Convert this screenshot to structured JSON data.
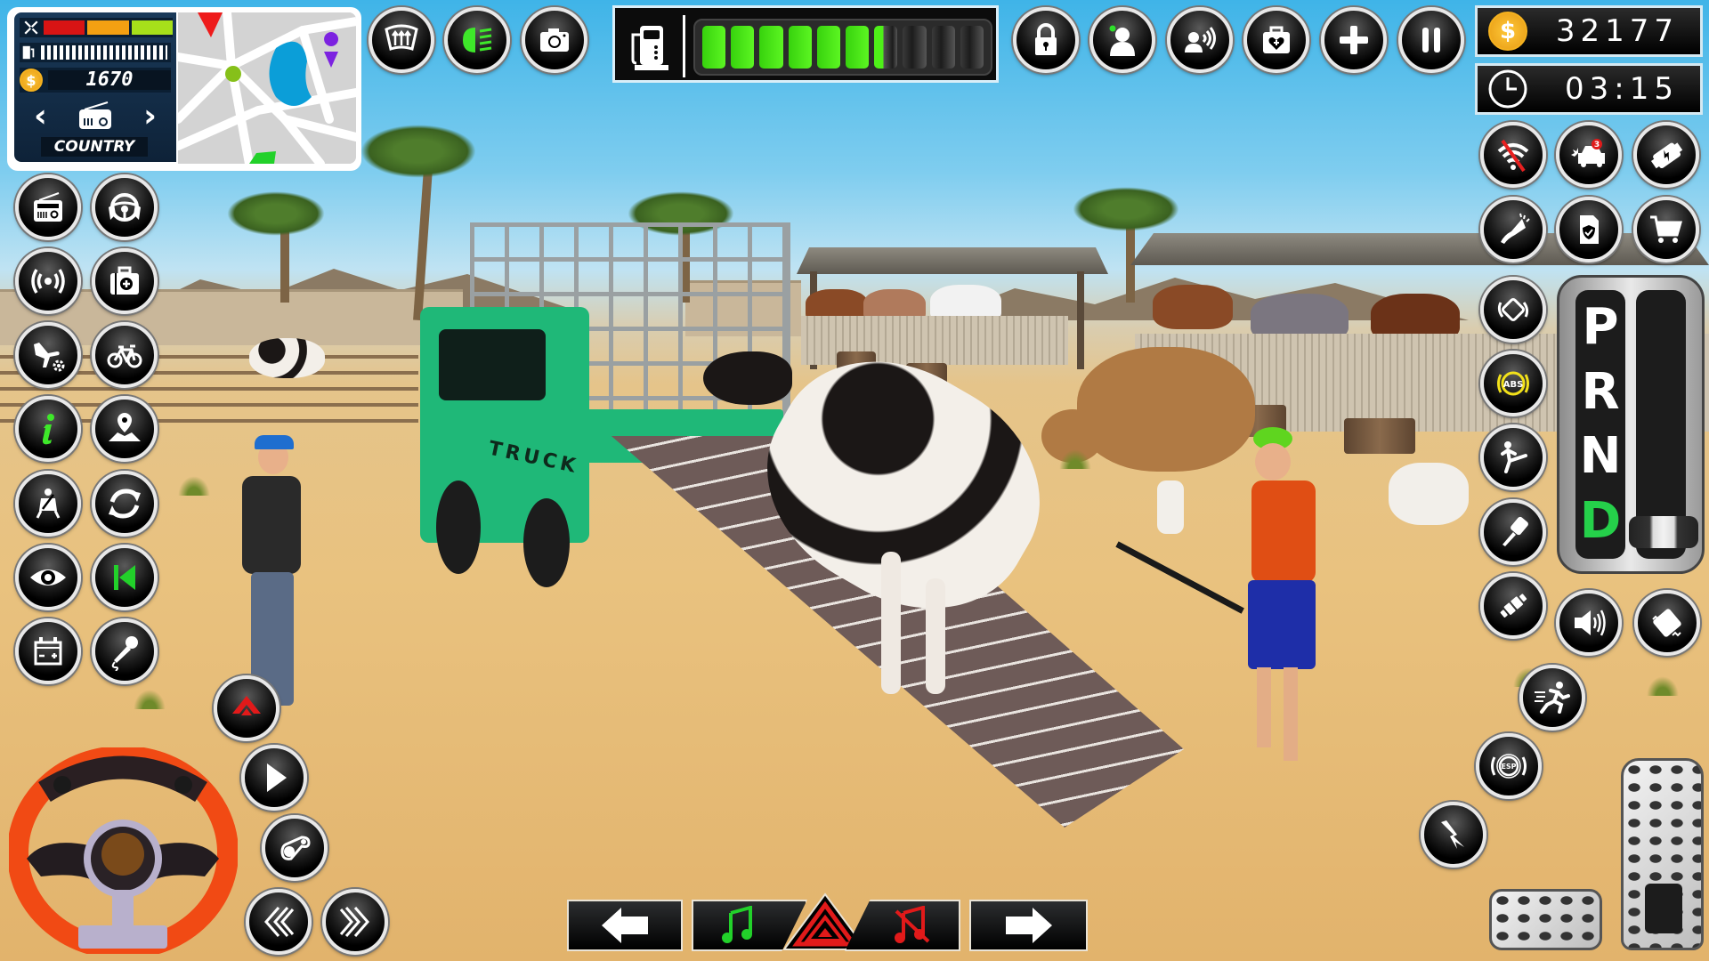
{
  "hud": {
    "dashboard": {
      "damage_segments": [
        {
          "name": "damage-low",
          "color": "#d81414"
        },
        {
          "name": "damage-mid",
          "color": "#f4a012"
        },
        {
          "name": "damage-high",
          "color": "#a6e01a"
        }
      ],
      "fuel_icon": "fuel-pump-icon",
      "coins": "1670",
      "radio_station": "COUNTRY",
      "prev_label": "‹",
      "next_label": "›"
    },
    "fuel_gauge": {
      "segments_total": 10,
      "level_percent": 64,
      "on_color": "#4ef018",
      "off_color": "#2a2a2a"
    },
    "total_coins": "32177",
    "timer": "03:15",
    "gear": {
      "options": [
        "P",
        "R",
        "N",
        "D"
      ],
      "selected": "D",
      "selected_color": "#25d04a"
    },
    "crash_badge": "3",
    "abs_label": "ABS",
    "esp_label": "ESP",
    "map": {
      "road_color": "#ffffff",
      "ground_color": "#d3d3d3",
      "water_color": "#0b9ed8",
      "player_marker_color": "#86c01a",
      "destination_pin_color": "#7c22e0",
      "waypoint_color": "#ee1b1b"
    }
  },
  "buttons": {
    "top_left": [
      {
        "name": "defrost-button",
        "icon": "windshield-defrost-icon"
      },
      {
        "name": "headlights-button",
        "icon": "headlight-icon"
      },
      {
        "name": "camera-button",
        "icon": "camera-icon"
      }
    ],
    "top_right": [
      {
        "name": "lock-button",
        "icon": "padlock-icon"
      },
      {
        "name": "passenger-button",
        "icon": "person-icon"
      },
      {
        "name": "voice-button",
        "icon": "person-speaking-icon"
      },
      {
        "name": "medkit-button",
        "icon": "medical-bag-icon"
      },
      {
        "name": "add-button",
        "icon": "plus-icon",
        "glyph": "+"
      },
      {
        "name": "pause-button",
        "icon": "pause-icon"
      }
    ],
    "left_column": [
      {
        "name": "radio-button",
        "icon": "radio-icon"
      },
      {
        "name": "steering-mode-button",
        "icon": "steering-wheel-hands-icon"
      },
      {
        "name": "hazard-signal-button",
        "icon": "broadcast-icon"
      },
      {
        "name": "first-aid-button",
        "icon": "first-aid-kit-icon"
      },
      {
        "name": "airplane-settings-button",
        "icon": "airplane-gear-icon"
      },
      {
        "name": "bicycle-button",
        "icon": "bicycle-icon"
      },
      {
        "name": "info-button",
        "icon": "info-icon",
        "glyph": "i"
      },
      {
        "name": "map-location-button",
        "icon": "map-pin-icon"
      },
      {
        "name": "seatbelt-button",
        "icon": "seatbelt-icon"
      },
      {
        "name": "reset-button",
        "icon": "refresh-icon"
      },
      {
        "name": "view-button",
        "icon": "eye-icon"
      },
      {
        "name": "restart-button",
        "icon": "skip-back-icon"
      },
      {
        "name": "battery-button",
        "icon": "battery-icon"
      },
      {
        "name": "microphone-button",
        "icon": "microphone-icon"
      }
    ],
    "right_grid": [
      {
        "name": "no-wifi-button",
        "icon": "wifi-off-icon"
      },
      {
        "name": "crash-button",
        "icon": "car-crash-icon"
      },
      {
        "name": "engine-button",
        "icon": "engine-icon"
      },
      {
        "name": "horn-button",
        "icon": "horn-icon"
      },
      {
        "name": "insurance-button",
        "icon": "document-shield-icon"
      },
      {
        "name": "shop-button",
        "icon": "shopping-cart-icon"
      }
    ],
    "right_column": [
      {
        "name": "rotate-camera-button",
        "icon": "rotate-icon"
      },
      {
        "name": "abs-button",
        "icon": "abs-icon"
      },
      {
        "name": "kick-button",
        "icon": "kick-icon"
      },
      {
        "name": "key-button",
        "icon": "car-key-icon"
      },
      {
        "name": "seatbelt-buckle-button",
        "icon": "buckle-icon"
      },
      {
        "name": "sound-button",
        "icon": "speaker-icon"
      },
      {
        "name": "ticket-button",
        "icon": "ticket-icon"
      },
      {
        "name": "sprint-button",
        "icon": "running-person-icon"
      },
      {
        "name": "esp-button",
        "icon": "esp-icon"
      },
      {
        "name": "nitro-button",
        "icon": "lightning-icon"
      }
    ],
    "bottom_left": [
      {
        "name": "warning-button",
        "icon": "warning-triangle-icon"
      },
      {
        "name": "play-button",
        "icon": "play-icon"
      },
      {
        "name": "toggle-button",
        "icon": "toggle-icon"
      },
      {
        "name": "steer-left-button",
        "icon": "double-chevron-left-icon"
      },
      {
        "name": "steer-right-button",
        "icon": "double-chevron-right-icon"
      }
    ],
    "bottom_bar": [
      {
        "name": "left-indicator-button",
        "icon": "arrow-left-icon"
      },
      {
        "name": "music-on-button",
        "icon": "music-note-icon",
        "color": "#22d12a"
      },
      {
        "name": "hazard-button",
        "icon": "hazard-triangle-icon",
        "color": "#e11a1a"
      },
      {
        "name": "music-off-button",
        "icon": "music-off-icon",
        "color": "#e11a1a"
      },
      {
        "name": "right-indicator-button",
        "icon": "arrow-right-icon"
      }
    ]
  },
  "scene": {
    "truck_label": "TRUCK"
  }
}
